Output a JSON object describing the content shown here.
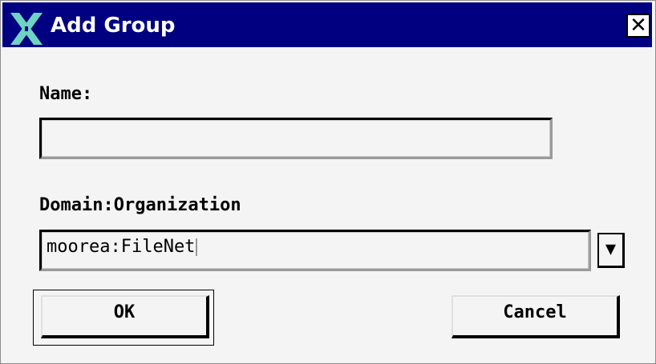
{
  "window": {
    "title": "Add Group",
    "close_label": "✕"
  },
  "form": {
    "name_label": "Name:",
    "name_value": "",
    "domain_label": "Domain:Organization",
    "domain_value": "moorea:FileNet",
    "dropdown_icon": "▼"
  },
  "buttons": {
    "ok_label": "OK",
    "cancel_label": "Cancel"
  },
  "colors": {
    "titlebar": "#000080",
    "window_bg": "#f4f4f4"
  }
}
